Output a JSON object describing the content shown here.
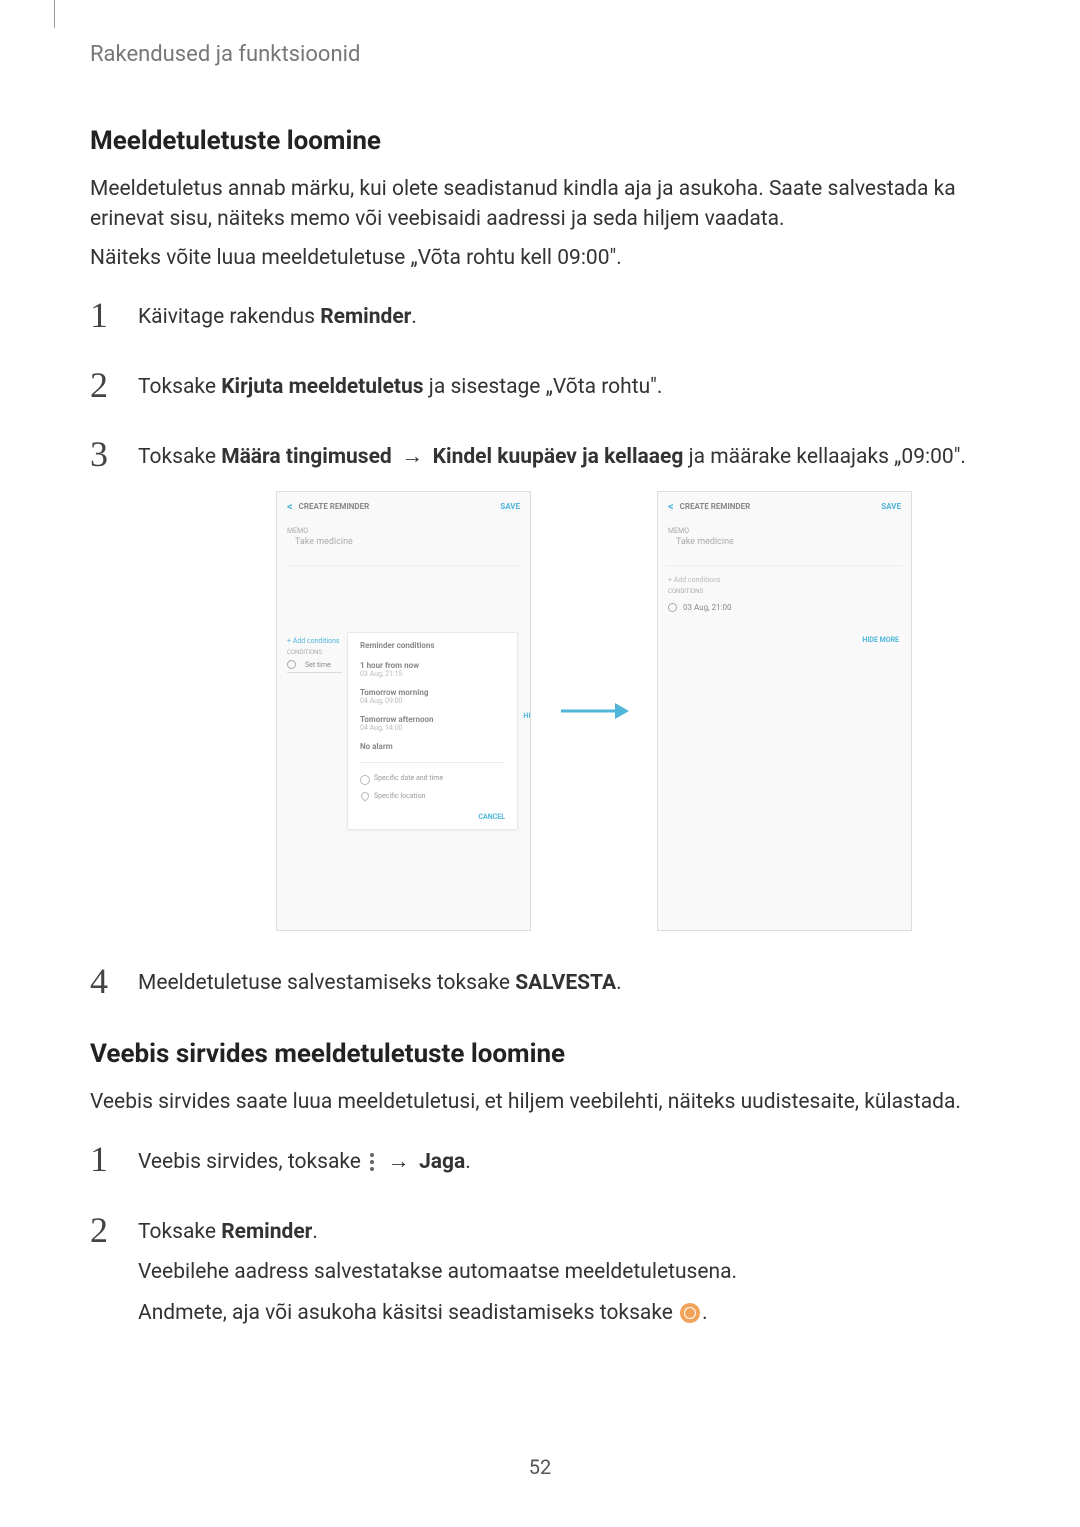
{
  "header": "Rakendused ja funktsioonid",
  "section1": {
    "title": "Meeldetuletuste loomine",
    "para1": "Meeldetuletus annab märku, kui olete seadistanud kindla aja ja asukoha. Saate salvestada ka erinevat sisu, näiteks memo või veebisaidi aadressi ja seda hiljem vaadata.",
    "para2": "Näiteks võite luua meeldetuletuse „Võta rohtu kell 09:00\".",
    "step1_pre": "Käivitage rakendus ",
    "step1_bold": "Reminder",
    "step1_post": ".",
    "step2_pre": "Toksake ",
    "step2_bold": "Kirjuta meeldetuletus",
    "step2_post": " ja sisestage „Võta rohtu\".",
    "step3_pre": "Toksake ",
    "step3_bold1": "Määra tingimused",
    "step3_arrow": " → ",
    "step3_bold2": "Kindel kuupäev ja kellaaeg",
    "step3_post": " ja määrake kellaajaks „09:00\".",
    "step4_pre": "Meeldetuletuse salvestamiseks toksake ",
    "step4_bold": "SALVESTA",
    "step4_post": "."
  },
  "phone": {
    "header_title": "CREATE REMINDER",
    "save": "SAVE",
    "memo_label": "MEMO",
    "memo_text": "Take medicine",
    "add_cond": "+ Add conditions",
    "cond_label": "CONDITIONS",
    "time_set": "Set time",
    "time_val": "03 Aug, 21:00",
    "hide": "HIDE MORE",
    "popup_title": "Reminder conditions",
    "opt1": "1 hour from now",
    "opt1_sub": "03 Aug, 21:15",
    "opt2": "Tomorrow morning",
    "opt2_sub": "04 Aug, 09:00",
    "opt3": "Tomorrow afternoon",
    "opt3_sub": "04 Aug, 14:00",
    "opt4": "No alarm",
    "spec_date": "Specific date and time",
    "spec_loc": "Specific location",
    "cancel": "CANCEL"
  },
  "section2": {
    "title": "Veebis sirvides meeldetuletuste loomine",
    "para1": "Veebis sirvides saate luua meeldetuletusi, et hiljem veebilehti, näiteks uudistesaite, külastada.",
    "step1_pre": "Veebis sirvides, toksake ",
    "step1_arrow": " → ",
    "step1_bold": "Jaga",
    "step1_post": ".",
    "step2_pre": "Toksake ",
    "step2_bold": "Reminder",
    "step2_post": ".",
    "step2_para1": "Veebilehe aadress salvestatakse automaatse meeldetuletusena.",
    "step2_para2_pre": "Andmete, aja või asukoha käsitsi seadistamiseks toksake ",
    "step2_para2_post": "."
  },
  "page_number": "52"
}
